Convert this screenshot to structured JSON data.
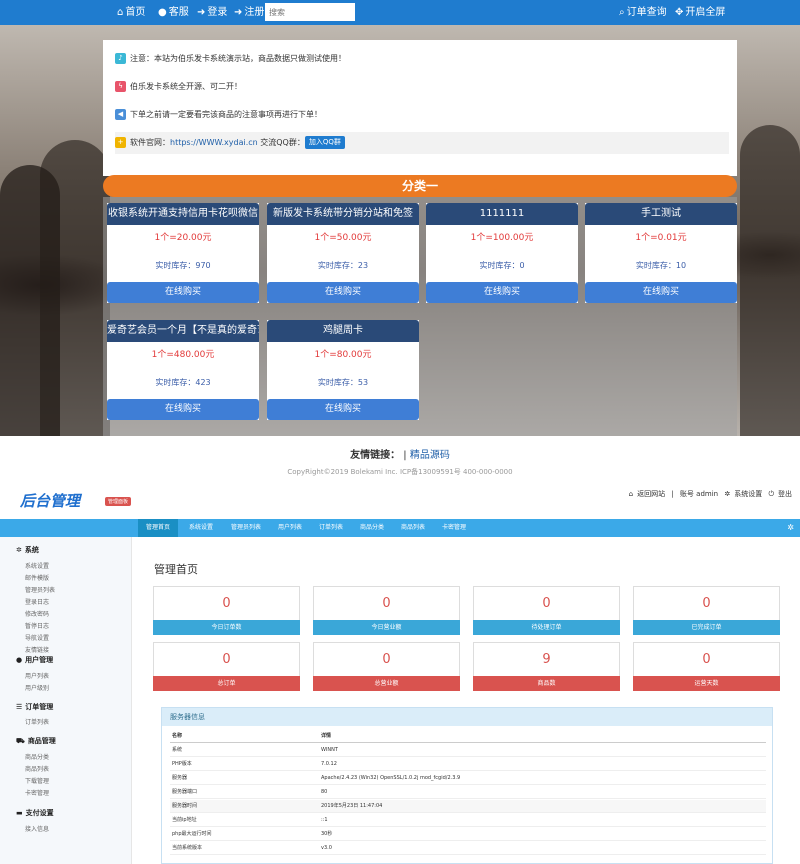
{
  "store": {
    "nav": {
      "home": "首页",
      "service": "客服",
      "login": "登录",
      "register": "注册",
      "search_placeholder": "搜索",
      "order_query": "订单查询",
      "fullscreen": "开启全屏"
    },
    "notices": [
      "注意：本站为伯乐发卡系统演示站，商品数据只做测试使用！",
      "伯乐发卡系统全开源、可二开！",
      "下单之前请一定要看完该商品的注意事项再进行下单！"
    ],
    "site": {
      "label": "软件官网：",
      "url": "https://WWW.xydai.cn",
      "qq_label": "交流QQ群：",
      "qq_button": "加入QQ群"
    },
    "category": "分类一",
    "stock_label": "实时库存：",
    "buy_label": "在线购买",
    "products": [
      {
        "name": "收银系统开通支持信用卡花呗微信",
        "price": "1个=20.00元",
        "stock": "970"
      },
      {
        "name": "新版发卡系统带分销分站和免签",
        "price": "1个=50.00元",
        "stock": "23"
      },
      {
        "name": "1111111",
        "price": "1个=100.00元",
        "stock": "0"
      },
      {
        "name": "手工测试",
        "price": "1个=0.01元",
        "stock": "10"
      },
      {
        "name": "爱奇艺会员一个月【不是真的爱奇艺",
        "price": "1个=480.00元",
        "stock": "423"
      },
      {
        "name": "鸡腿周卡",
        "price": "1个=80.00元",
        "stock": "53"
      }
    ],
    "friends_label": "友情链接：",
    "friends_link": "精品源码",
    "copyright": "CopyRight©2019 Bolekami Inc.   ICP备13009591号   400-000-0000"
  },
  "admin": {
    "logo": "后台管理",
    "tag": "管理面板",
    "tools": {
      "home": "返回网站",
      "account": "账号 admin",
      "settings": "系统设置",
      "logout": "登出"
    },
    "tabs": [
      "管理首页",
      "系统设置",
      "管理员列表",
      "用户列表",
      "订单列表",
      "商品分类",
      "商品列表",
      "卡密管理"
    ],
    "sidebar": [
      {
        "title": "系统",
        "items": [
          "系统设置",
          "邮件模版",
          "管理员列表",
          "登录日志",
          "修改密码",
          "暂停日志",
          "导航设置",
          "友情链接"
        ]
      },
      {
        "title": "用户管理",
        "items": [
          "用户列表",
          "用户级别"
        ]
      },
      {
        "title": "订单管理",
        "items": [
          "订单列表"
        ]
      },
      {
        "title": "商品管理",
        "items": [
          "商品分类",
          "商品列表",
          "下载管理",
          "卡密管理"
        ]
      },
      {
        "title": "支付设置",
        "items": [
          "接入信息"
        ]
      }
    ],
    "title": "管理首页",
    "stats": [
      {
        "value": "0",
        "label": "今日订单数"
      },
      {
        "value": "0",
        "label": "今日营业额"
      },
      {
        "value": "0",
        "label": "待处理订单"
      },
      {
        "value": "0",
        "label": "已完成订单"
      },
      {
        "value": "0",
        "label": "总订单"
      },
      {
        "value": "0",
        "label": "总营业额"
      },
      {
        "value": "9",
        "label": "商品数"
      },
      {
        "value": "0",
        "label": "运营天数"
      }
    ],
    "server": {
      "title": "服务器信息",
      "headers": [
        "名称",
        "详情"
      ],
      "rows": [
        [
          "系统",
          "WINNT"
        ],
        [
          "PHP版本",
          "7.0.12"
        ],
        [
          "服务器",
          "Apache/2.4.23 (Win32) OpenSSL/1.0.2j mod_fcgid/2.3.9"
        ],
        [
          "服务器端口",
          "80"
        ],
        [
          "服务器时间",
          "2019年5月23日 11:47:04"
        ],
        [
          "当前ip地址",
          "::1"
        ],
        [
          "php最大运行时间",
          "30秒"
        ],
        [
          "当前系统版本",
          "v3.0"
        ]
      ]
    }
  }
}
